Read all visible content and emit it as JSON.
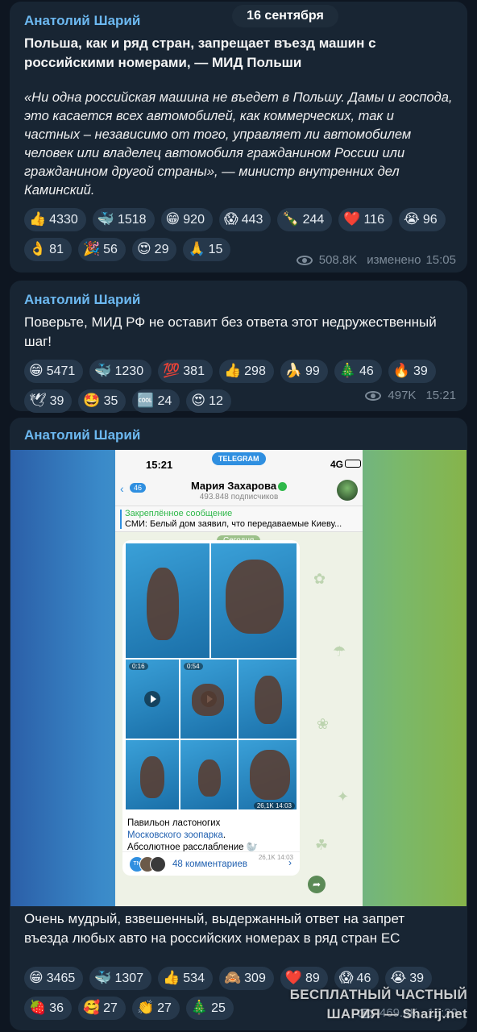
{
  "date_pill": "16 сентября",
  "messages": [
    {
      "author": "Анатолий Шарий",
      "title": "Польша, как и ряд стран, запрещает въезд машин с российскими номерами, — МИД Польши",
      "body": "«Ни одна российская машина не въедет в Польшу. Дамы и господа, это касается всех автомобилей, как коммерческих, так и частных – независимо от того, управляет ли автомобилем человек или владелец автомобиля гражданином России или гражданином другой страны», — министр внутренних дел Каминский.",
      "reactions": [
        {
          "icon": "thumbs-up",
          "emoji": "👍",
          "count": "4330"
        },
        {
          "icon": "whale",
          "emoji": "🐳",
          "count": "1518"
        },
        {
          "icon": "grin",
          "emoji": "😁",
          "count": "920"
        },
        {
          "icon": "scream",
          "emoji": "😱",
          "count": "443"
        },
        {
          "icon": "champagne",
          "emoji": "🍾",
          "count": "244"
        },
        {
          "icon": "heart",
          "emoji": "❤️",
          "count": "116"
        },
        {
          "icon": "sob",
          "emoji": "😭",
          "count": "96"
        },
        {
          "icon": "ok-hand",
          "emoji": "👌",
          "count": "81"
        },
        {
          "icon": "party",
          "emoji": "🎉",
          "count": "56"
        },
        {
          "icon": "heart-eyes",
          "emoji": "😍",
          "count": "29"
        },
        {
          "icon": "pray",
          "emoji": "🙏",
          "count": "15"
        }
      ],
      "views": "508.8K",
      "edited": "изменено",
      "time": "15:05"
    },
    {
      "author": "Анатолий Шарий",
      "text": "Поверьте, МИД РФ не оставит без ответа этот недружественный шаг!",
      "reactions": [
        {
          "icon": "grin",
          "emoji": "😁",
          "count": "5471"
        },
        {
          "icon": "whale",
          "emoji": "🐳",
          "count": "1230"
        },
        {
          "icon": "hundred",
          "emoji": "💯",
          "count": "381"
        },
        {
          "icon": "thumbs-up",
          "emoji": "👍",
          "count": "298"
        },
        {
          "icon": "banana",
          "emoji": "🍌",
          "count": "99"
        },
        {
          "icon": "christmas-tree",
          "emoji": "🎄",
          "count": "46"
        },
        {
          "icon": "fire",
          "emoji": "🔥",
          "count": "39"
        },
        {
          "icon": "dove",
          "emoji": "🕊",
          "count": "39"
        },
        {
          "icon": "star-struck",
          "emoji": "🤩",
          "count": "35"
        },
        {
          "icon": "cool",
          "emoji": "🆒",
          "count": "24"
        },
        {
          "icon": "heart-eyes",
          "emoji": "😍",
          "count": "12"
        }
      ],
      "views": "497K",
      "time": "15:21"
    },
    {
      "author": "Анатолий Шарий",
      "text": "Очень мудрый, взвешенный, выдержанный ответ на запрет въезда любых авто на российских номерах в ряд стран ЕС",
      "reactions": [
        {
          "icon": "grin",
          "emoji": "😁",
          "count": "3465"
        },
        {
          "icon": "whale",
          "emoji": "🐳",
          "count": "1307"
        },
        {
          "icon": "thumbs-up",
          "emoji": "👍",
          "count": "534"
        },
        {
          "icon": "see-no-evil",
          "emoji": "🙈",
          "count": "309"
        },
        {
          "icon": "heart",
          "emoji": "❤️",
          "count": "89"
        },
        {
          "icon": "scream",
          "emoji": "😱",
          "count": "46"
        },
        {
          "icon": "sob",
          "emoji": "😭",
          "count": "39"
        },
        {
          "icon": "strawberry",
          "emoji": "🍓",
          "count": "36"
        },
        {
          "icon": "hearts-face",
          "emoji": "🥰",
          "count": "27"
        },
        {
          "icon": "clap",
          "emoji": "👏",
          "count": "27"
        },
        {
          "icon": "christmas-tree",
          "emoji": "🎄",
          "count": "25"
        }
      ],
      "views": "469.6K",
      "time": "15:22"
    }
  ],
  "screenshot": {
    "time": "15:21",
    "app_badge": "TELEGRAM",
    "network": "4G",
    "back_count": "46",
    "channel_name": "Мария Захарова",
    "subscribers": "493.848 подписчиков",
    "pinned_label": "Закреплённое сообщение",
    "pinned_text": "СМИ: Белый дом заявил, что передаваемые Киеву...",
    "today": "Сегодня",
    "video1_duration": "0:16",
    "video2_duration": "0:54",
    "grid_meta": "26,1K 14:03",
    "caption_line1": "Павильон ластоногих",
    "caption_link": "Московского зоопарка",
    "caption_line3": "Абсолютное расслабление",
    "caption_meta": "26,1K 14:03",
    "avatar_initials": "TN",
    "comments": "48 комментариев"
  },
  "watermark": {
    "line1": "БЕСПЛАТНЫЙ ЧАСТНЫЙ",
    "line2": "ШАРИЯ — Sharij.net"
  }
}
